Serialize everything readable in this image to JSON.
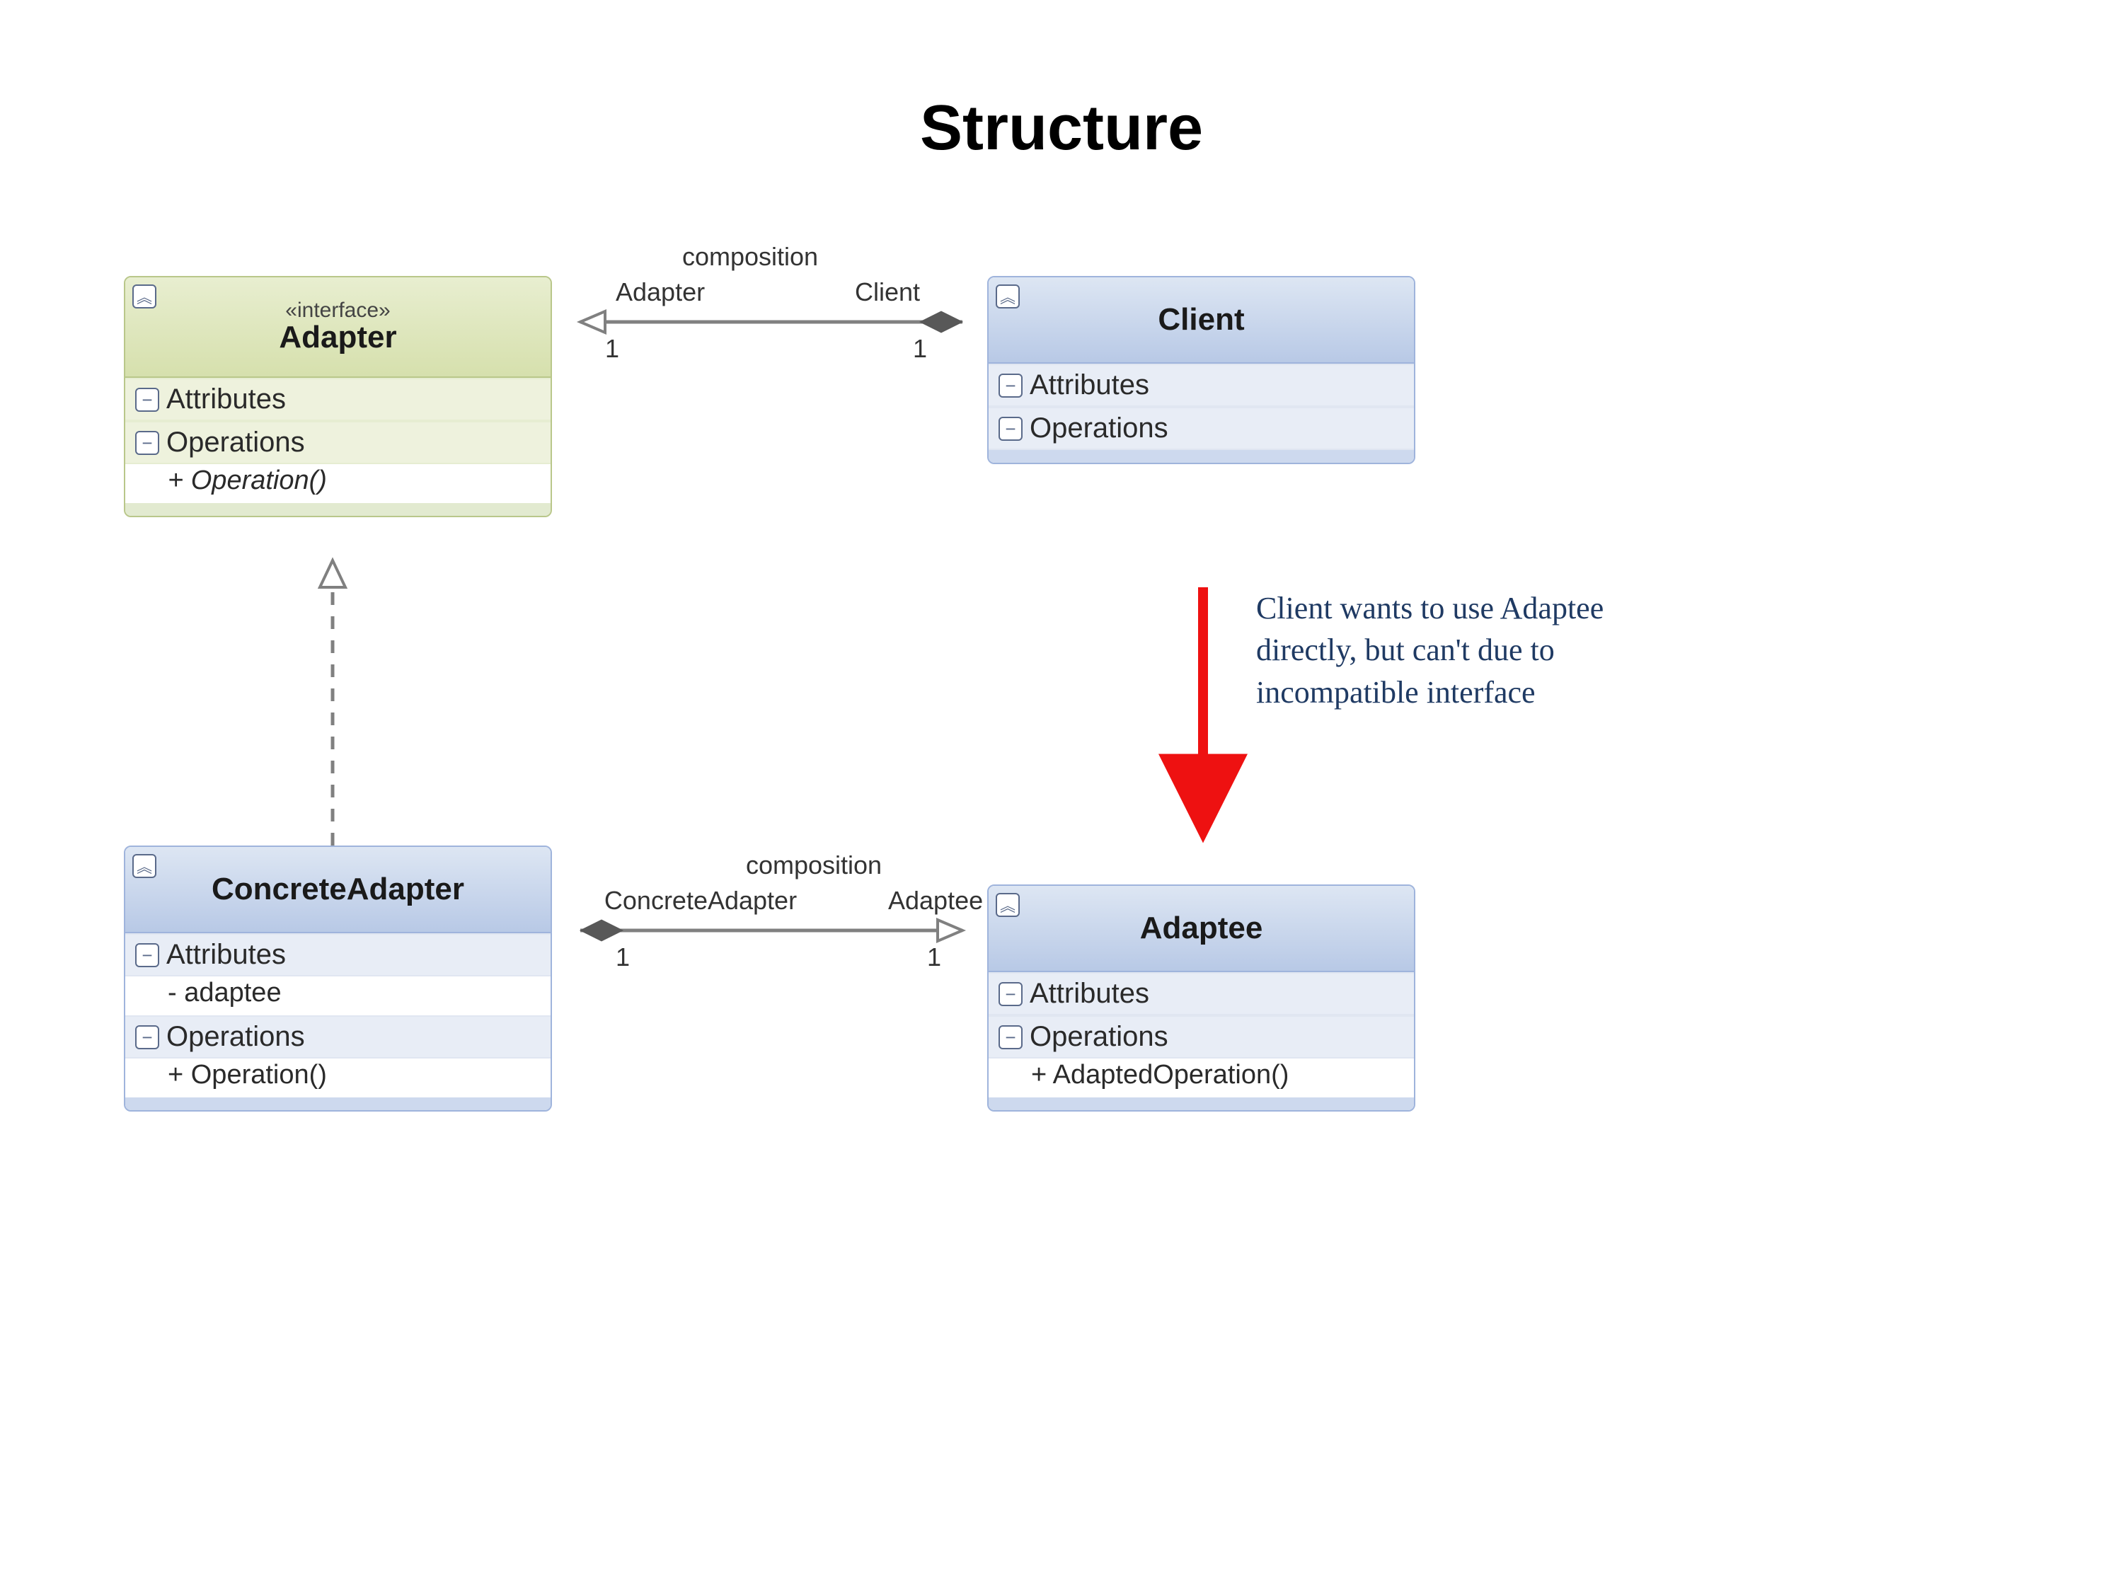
{
  "title": "Structure",
  "classes": {
    "adapter": {
      "stereotype": "«interface»",
      "name": "Adapter",
      "sections": {
        "attributes": "Attributes",
        "operations": "Operations"
      },
      "members": {
        "op1": "+ Operation()"
      }
    },
    "client": {
      "name": "Client",
      "sections": {
        "attributes": "Attributes",
        "operations": "Operations"
      }
    },
    "concrete": {
      "name": "ConcreteAdapter",
      "sections": {
        "attributes": "Attributes",
        "operations": "Operations"
      },
      "members": {
        "attr1": "- adaptee",
        "op1": "+ Operation()"
      }
    },
    "adaptee": {
      "name": "Adaptee",
      "sections": {
        "attributes": "Attributes",
        "operations": "Operations"
      },
      "members": {
        "op1": "+ AdaptedOperation()"
      }
    }
  },
  "relations": {
    "r1": {
      "label": "composition",
      "endA": "Adapter",
      "endB": "Client",
      "multA": "1",
      "multB": "1"
    },
    "r2": {
      "label": "composition",
      "endA": "ConcreteAdapter",
      "endB": "Adaptee",
      "multA": "1",
      "multB": "1"
    }
  },
  "annotation": "Client wants to use Adaptee directly, but can't due to incompatible interface",
  "glyphs": {
    "minus": "−",
    "chev": "︽"
  }
}
